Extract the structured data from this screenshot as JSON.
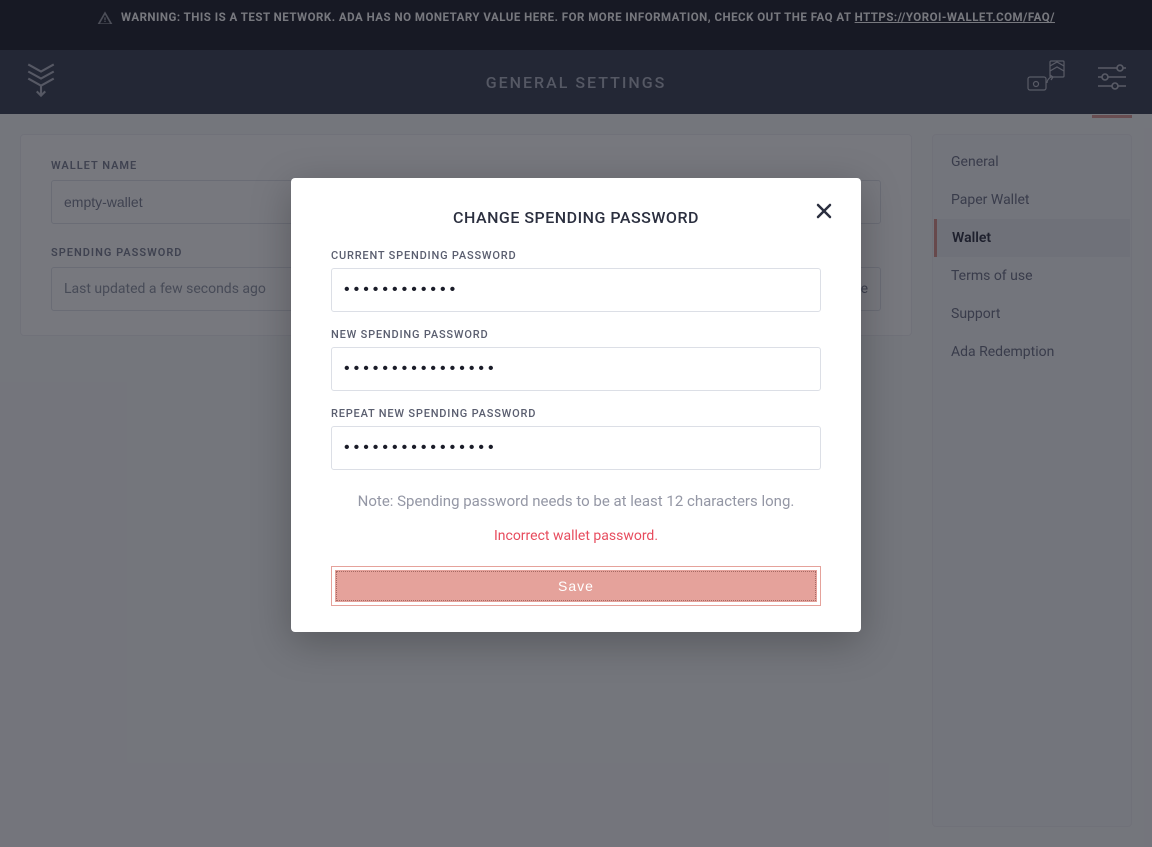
{
  "warning": {
    "prefix": "WARNING: THIS IS A TEST NETWORK. ADA HAS NO MONETARY VALUE HERE. FOR MORE INFORMATION, CHECK OUT THE FAQ AT ",
    "link_text": "HTTPS://YOROI-WALLET.COM/FAQ/"
  },
  "header": {
    "title": "GENERAL SETTINGS"
  },
  "wallet_settings": {
    "wallet_name_label": "WALLET NAME",
    "wallet_name_value": "empty-wallet",
    "spending_password_label": "SPENDING PASSWORD",
    "spending_password_status": "Last updated a few seconds ago",
    "change_action": "change"
  },
  "sidebar": {
    "items": [
      {
        "label": "General",
        "active": false
      },
      {
        "label": "Paper Wallet",
        "active": false
      },
      {
        "label": "Wallet",
        "active": true
      },
      {
        "label": "Terms of use",
        "active": false
      },
      {
        "label": "Support",
        "active": false
      },
      {
        "label": "Ada Redemption",
        "active": false
      }
    ]
  },
  "dialog": {
    "title": "CHANGE SPENDING PASSWORD",
    "current_label": "CURRENT SPENDING PASSWORD",
    "current_value": "••••••••••••",
    "new_label": "NEW SPENDING PASSWORD",
    "new_value": "••••••••••••••••",
    "repeat_label": "REPEAT NEW SPENDING PASSWORD",
    "repeat_value": "••••••••••••••••",
    "note": "Note: Spending password needs to be at least 12 characters long.",
    "error": "Incorrect wallet password.",
    "save": "Save"
  }
}
